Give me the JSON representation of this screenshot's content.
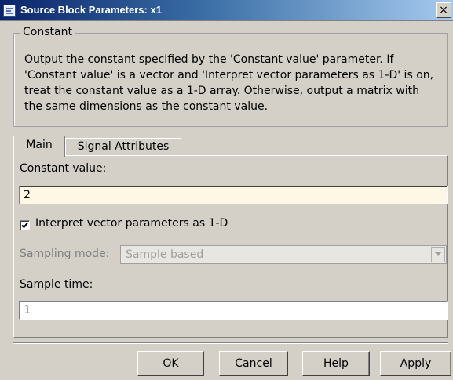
{
  "window": {
    "title": "Source Block Parameters: x1",
    "close_label": "×"
  },
  "group": {
    "title": "Constant",
    "description": "Output the constant specified by the 'Constant value' parameter. If 'Constant value' is a vector and 'Interpret vector parameters as 1-D' is on, treat the constant value as a 1-D array. Otherwise, output a matrix with the same dimensions as the constant value."
  },
  "tabs": [
    {
      "label": "Main",
      "active": true
    },
    {
      "label": "Signal Attributes",
      "active": false
    }
  ],
  "main": {
    "constant_label": "Constant value:",
    "constant_value": "2",
    "interpret_label": "Interpret vector parameters as 1-D",
    "interpret_checked": true,
    "sampling_label": "Sampling mode:",
    "sampling_value": "Sample based",
    "sample_time_label": "Sample time:",
    "sample_time_value": "1"
  },
  "buttons": {
    "ok": "OK",
    "cancel": "Cancel",
    "help": "Help",
    "apply": "Apply"
  },
  "colors": {
    "title_gradient_start": "#0a246a",
    "dialog_background": "#d4d0c8",
    "edited_field_background": "#fff7e6"
  }
}
